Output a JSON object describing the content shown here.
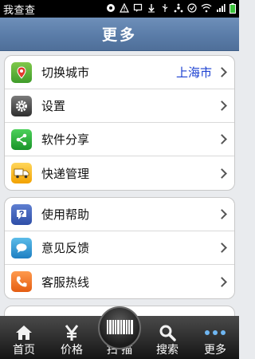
{
  "status_bar": {
    "app_name": "我查查",
    "icons": [
      "bell-icon",
      "alert-icon",
      "chat-icon",
      "download-icon",
      "usb-icon",
      "network-icon",
      "check-icon",
      "wifi-icon",
      "signal-icon",
      "battery-icon"
    ]
  },
  "header": {
    "title": "更多"
  },
  "groups": [
    {
      "items": [
        {
          "label": "切换城市",
          "value": "上海市",
          "icon": "map-pin-icon"
        },
        {
          "label": "设置",
          "value": "",
          "icon": "gear-icon"
        },
        {
          "label": "软件分享",
          "value": "",
          "icon": "share-icon"
        },
        {
          "label": "快递管理",
          "value": "",
          "icon": "truck-icon"
        }
      ]
    },
    {
      "items": [
        {
          "label": "使用帮助",
          "value": "",
          "icon": "help-icon"
        },
        {
          "label": "意见反馈",
          "value": "",
          "icon": "feedback-icon"
        },
        {
          "label": "客服热线",
          "value": "",
          "icon": "phone-icon"
        }
      ]
    }
  ],
  "tabbar": {
    "items": [
      {
        "label": "首页",
        "icon": "home-icon"
      },
      {
        "label": "价格",
        "icon": "yen-icon"
      },
      {
        "label": "扫 描",
        "icon": "barcode-scan-icon"
      },
      {
        "label": "搜索",
        "icon": "search-icon"
      },
      {
        "label": "更多",
        "icon": "more-dots-icon"
      }
    ]
  }
}
